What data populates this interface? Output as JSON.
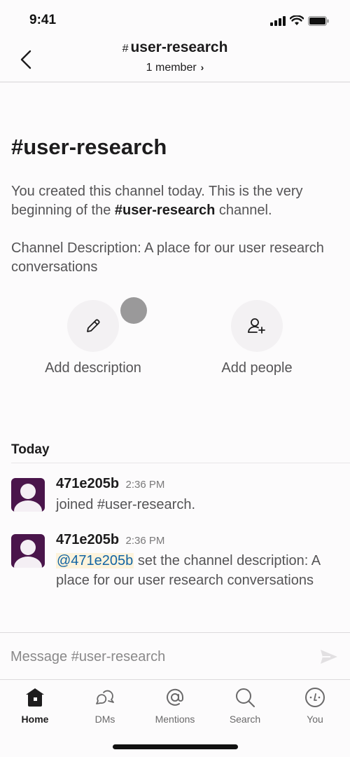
{
  "status_bar": {
    "time": "9:41"
  },
  "header": {
    "hash": "#",
    "channel_name": "user-research",
    "members": "1 member",
    "members_chevron": "›"
  },
  "intro": {
    "channel_title": "#user-research",
    "created_prefix": "You created this channel today. This is the very beginning of the ",
    "created_channel": "#user-research",
    "created_suffix": " channel.",
    "description": "Channel Description: A place for our user research conversations"
  },
  "actions": [
    {
      "label": "Add description",
      "icon": "pencil-icon"
    },
    {
      "label": "Add people",
      "icon": "add-person-icon"
    }
  ],
  "day_label": "Today",
  "messages": [
    {
      "user": "471e205b",
      "time": "2:36 PM",
      "text": "joined #user-research."
    },
    {
      "user": "471e205b",
      "time": "2:36 PM",
      "mention": "@471e205b",
      "text": " set the channel description: A place for our user research conversations"
    }
  ],
  "composer": {
    "placeholder": "Message #user-research",
    "value": ""
  },
  "tabs": [
    {
      "label": "Home",
      "icon": "home-icon",
      "active": true
    },
    {
      "label": "DMs",
      "icon": "dms-icon",
      "active": false
    },
    {
      "label": "Mentions",
      "icon": "at-icon",
      "active": false
    },
    {
      "label": "Search",
      "icon": "search-icon",
      "active": false
    },
    {
      "label": "You",
      "icon": "you-icon",
      "active": false
    }
  ],
  "colors": {
    "avatar_bg": "#4a154b",
    "mention_text": "#1264a3",
    "mention_bg": "#fdf3dc",
    "text_primary": "#1d1c1d",
    "text_secondary": "#555456"
  }
}
